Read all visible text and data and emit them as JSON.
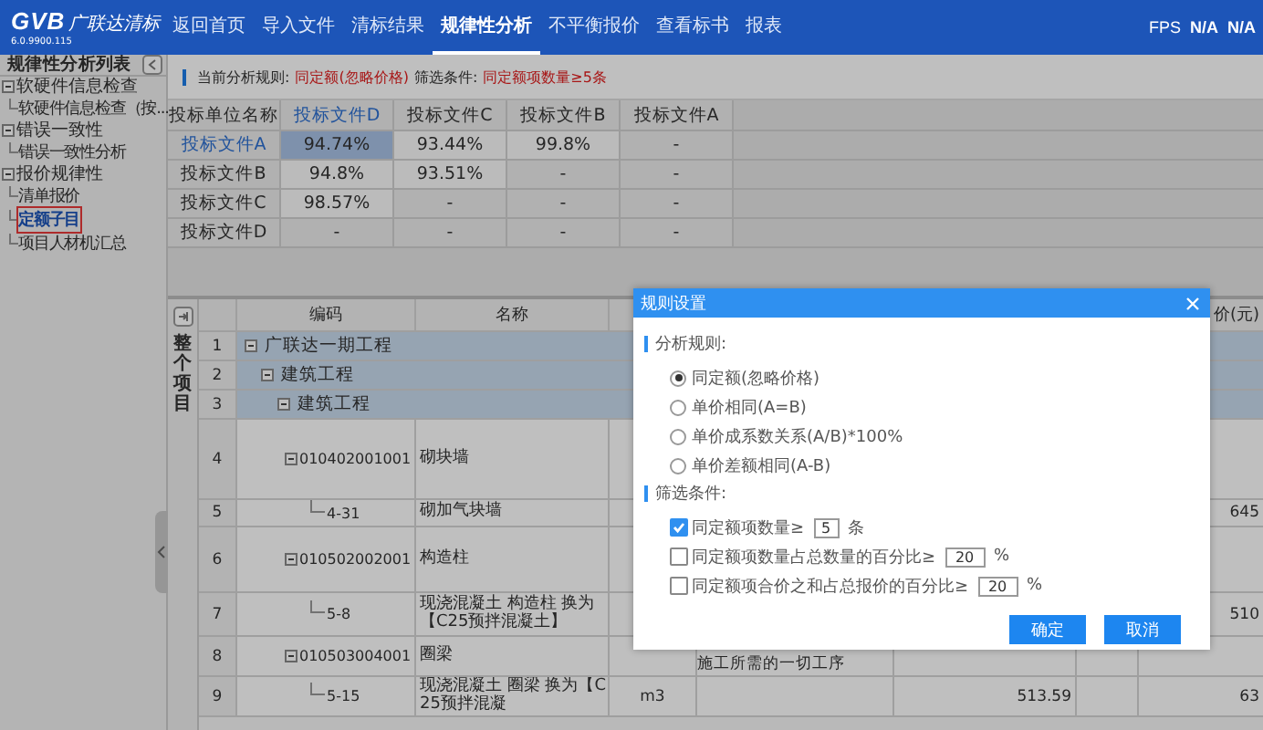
{
  "app": {
    "logo": "GVB",
    "name": "广联达清标",
    "version": "6.0.9900.115"
  },
  "nav": [
    {
      "label": "返回首页",
      "selected": false
    },
    {
      "label": "导入文件",
      "selected": false
    },
    {
      "label": "清标结果",
      "selected": false
    },
    {
      "label": "规律性分析",
      "selected": true
    },
    {
      "label": "不平衡报价",
      "selected": false
    },
    {
      "label": "查看标书",
      "selected": false
    },
    {
      "label": "报表",
      "selected": false
    }
  ],
  "status": {
    "fps_label": "FPS",
    "values": [
      "N/A",
      "N/A"
    ]
  },
  "sidebar": {
    "title": "规律性分析列表",
    "items": [
      {
        "label": "软硬件信息检查",
        "selected": false,
        "expanded": true,
        "children": [
          {
            "label": "软硬件信息检查（按...",
            "selected": false
          }
        ]
      },
      {
        "label": "错误一致性",
        "selected": false,
        "expanded": true,
        "children": [
          {
            "label": "错误一致性分析",
            "selected": false
          }
        ]
      },
      {
        "label": "报价规律性",
        "selected": false,
        "expanded": true,
        "children": [
          {
            "label": "清单报价",
            "selected": false
          },
          {
            "label": "定额子目",
            "selected": true
          },
          {
            "label": "项目人材机汇总",
            "selected": false
          }
        ]
      }
    ]
  },
  "info": {
    "rule_label": "当前分析规则:",
    "rule_value": "同定额(忽略价格)",
    "filter_label": "筛选条件:",
    "filter_value": "同定额项数量≥5条"
  },
  "matrix": {
    "corner": "投标单位名称",
    "columns": [
      {
        "label": "投标文件D",
        "selected": true
      },
      {
        "label": "投标文件C",
        "selected": false
      },
      {
        "label": "投标文件B",
        "selected": false
      },
      {
        "label": "投标文件A",
        "selected": false
      }
    ],
    "rows": [
      {
        "label": "投标文件A",
        "selected": true,
        "cells": [
          {
            "value": "94.74%",
            "kind": "score"
          },
          {
            "value": "93.44%",
            "kind": "score"
          },
          {
            "value": "99.8%",
            "kind": "score"
          },
          {
            "value": "-",
            "kind": "none"
          }
        ]
      },
      {
        "label": "投标文件B",
        "selected": false,
        "cells": [
          {
            "value": "94.8%",
            "kind": "score"
          },
          {
            "value": "93.51%",
            "kind": "score"
          },
          {
            "value": "-",
            "kind": "none"
          },
          {
            "value": "-",
            "kind": "none"
          }
        ]
      },
      {
        "label": "投标文件C",
        "selected": false,
        "cells": [
          {
            "value": "98.57%",
            "kind": "score"
          },
          {
            "value": "-",
            "kind": "none"
          },
          {
            "value": "-",
            "kind": "none"
          },
          {
            "value": "-",
            "kind": "none"
          }
        ]
      },
      {
        "label": "投标文件D",
        "selected": false,
        "cells": [
          {
            "value": "-",
            "kind": "none"
          },
          {
            "value": "-",
            "kind": "none"
          },
          {
            "value": "-",
            "kind": "none"
          },
          {
            "value": "-",
            "kind": "none"
          }
        ]
      }
    ]
  },
  "scope_label": "整个项目",
  "items": {
    "columns": {
      "code": "编码",
      "name": "名称",
      "column_8": "价(元)"
    },
    "rows": [
      {
        "num": "1",
        "name": "广联达一期工程",
        "expanded": true,
        "children": [
          {
            "num": "2",
            "name": "建筑工程",
            "expanded": true,
            "children": [
              {
                "num": "3",
                "name": "建筑工程",
                "expanded": true,
                "children": [
                  {
                    "num": "4",
                    "code": "010402001001",
                    "name": "砌块墙",
                    "expanded": true,
                    "children": [
                      {
                        "num": "5",
                        "code": "4-31",
                        "name": "砌加气块墙",
                        "column_8": "645"
                      }
                    ]
                  },
                  {
                    "num": "6",
                    "code": "010502002001",
                    "name": "构造柱",
                    "expanded": true,
                    "children": [
                      {
                        "num": "7",
                        "code": "5-8",
                        "name": "现浇混凝土 构造柱 换为【C25预拌混凝土】",
                        "column_8": "510"
                      }
                    ]
                  },
                  {
                    "num": "8",
                    "code": "010503004001",
                    "name": "圈梁",
                    "column_5": "施工所需的一切工序",
                    "expanded": true,
                    "children": [
                      {
                        "num": "9",
                        "code": "5-15",
                        "name": "现浇混凝土 圈梁 换为【C25预拌混凝",
                        "unit": "m3",
                        "column_6": "513.59",
                        "column_8": "63"
                      }
                    ]
                  }
                ]
              }
            ]
          }
        ]
      }
    ]
  },
  "dialog": {
    "title": "规则设置",
    "rules_heading": "分析规则:",
    "rules": [
      {
        "label": "同定额(忽略价格)",
        "selected": true
      },
      {
        "label": "单价相同(A=B)",
        "selected": false
      },
      {
        "label": "单价成系数关系(A/B)*100%",
        "selected": false
      },
      {
        "label": "单价差额相同(A-B)",
        "selected": false
      }
    ],
    "filters_heading": "筛选条件:",
    "filters": [
      {
        "label": "同定额项数量≥",
        "value": "5",
        "unit": "条",
        "checked": true
      },
      {
        "label": "同定额项数量占总数量的百分比≥",
        "value": "20",
        "unit": "%",
        "checked": false
      },
      {
        "label": "同定额项合价之和占总报价的百分比≥",
        "value": "20",
        "unit": "%",
        "checked": false
      }
    ],
    "buttons": [
      "确定",
      "取消"
    ]
  }
}
